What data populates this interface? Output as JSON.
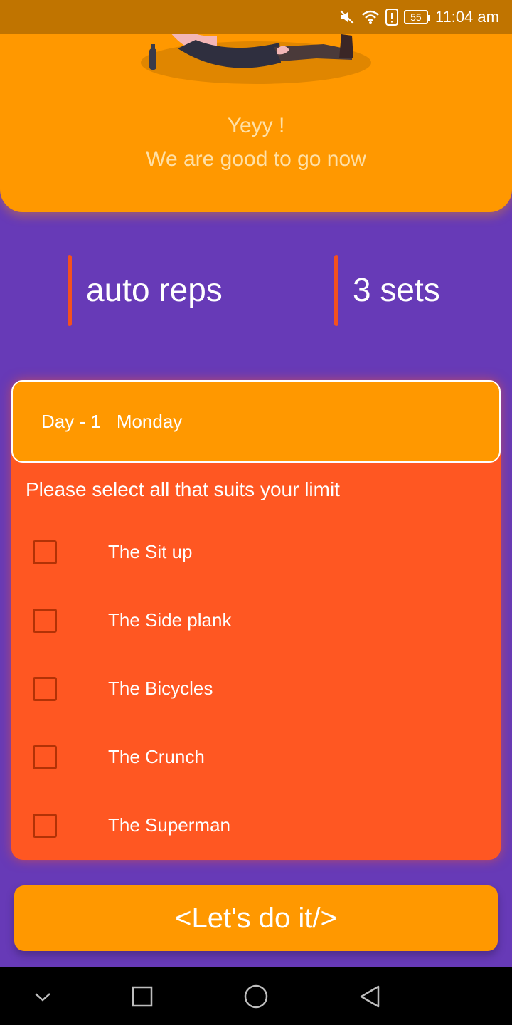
{
  "status_bar": {
    "battery_level": "55",
    "time": "11:04 am",
    "icons": [
      "mute-icon",
      "wifi-icon",
      "alert-icon",
      "battery-icon"
    ]
  },
  "hero": {
    "line1": "Yeyy !",
    "line2": "We are good to go now",
    "background_color": "#ff9800"
  },
  "stats": {
    "reps_label": "auto reps",
    "sets_label": "3 sets",
    "accent_color": "#f4511e"
  },
  "day_card": {
    "day_label": "Day - 1",
    "weekday": "Monday",
    "instruction": "Please select all that suits your limit",
    "background_color": "#ff5722",
    "exercises": [
      {
        "label": "The Sit up",
        "checked": false
      },
      {
        "label": "The Side plank",
        "checked": false
      },
      {
        "label": "The Bicycles",
        "checked": false
      },
      {
        "label": "The Crunch",
        "checked": false
      },
      {
        "label": "The Superman",
        "checked": false
      }
    ]
  },
  "cta": {
    "label": "<Let's do it/>"
  },
  "nav_bar": {
    "icons": [
      "chevron-down-icon",
      "square-icon",
      "circle-icon",
      "back-triangle-icon"
    ]
  }
}
